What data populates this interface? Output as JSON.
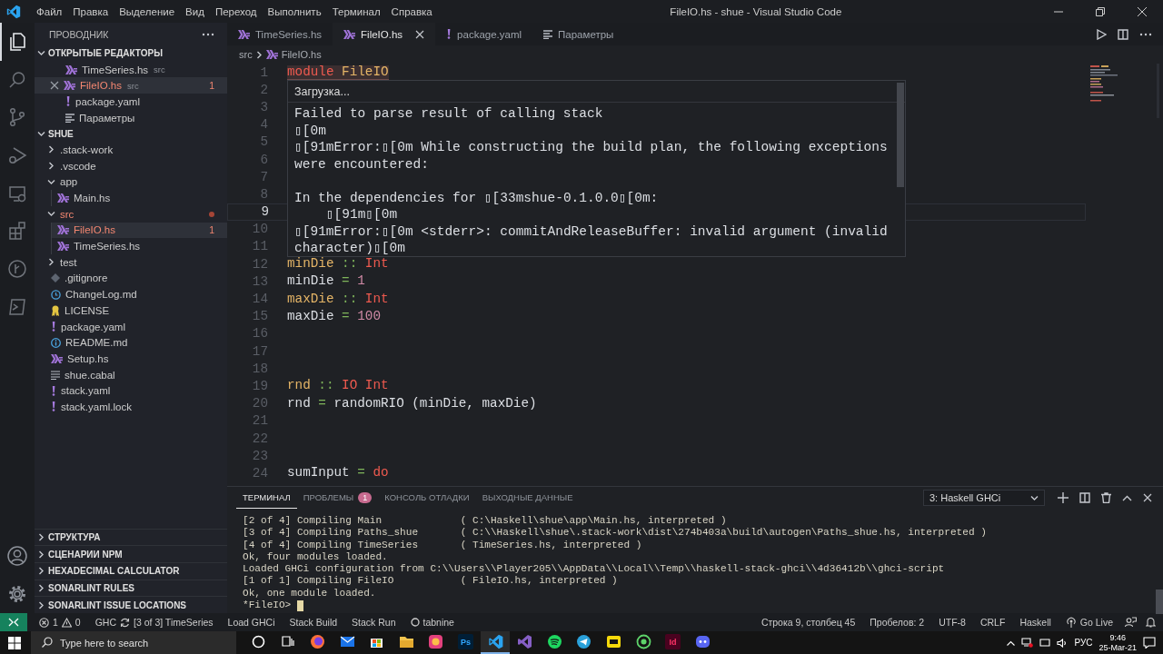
{
  "window": {
    "title": "FileIO.hs - shue - Visual Studio Code",
    "menu": [
      "Файл",
      "Правка",
      "Выделение",
      "Вид",
      "Переход",
      "Выполнить",
      "Терминал",
      "Справка"
    ]
  },
  "activity_bar": {
    "items": [
      {
        "kind": "explorer",
        "selected": true
      },
      {
        "kind": "search",
        "selected": false
      },
      {
        "kind": "source_control",
        "selected": false
      },
      {
        "kind": "run",
        "selected": false
      },
      {
        "kind": "remote",
        "selected": false
      },
      {
        "kind": "extensions",
        "selected": false
      },
      {
        "kind": "git_graph",
        "selected": false
      },
      {
        "kind": "terminal",
        "selected": false
      }
    ],
    "bottom": [
      {
        "kind": "account"
      },
      {
        "kind": "manage"
      }
    ]
  },
  "sidebar": {
    "title": "ПРОВОДНИК",
    "open_editors": {
      "title": "ОТКРЫТЫЕ РЕДАКТОРЫ",
      "expanded": true,
      "items": [
        {
          "name": "TimeSeries.hs",
          "kind": "haskell",
          "path": "src",
          "error": false,
          "selected": false
        },
        {
          "name": "FileIO.hs",
          "kind": "haskell",
          "path": "src",
          "error": true,
          "problems": "1",
          "selected": true
        },
        {
          "name": "package.yaml",
          "kind": "yaml",
          "error": false,
          "selected": false
        },
        {
          "name": "Параметры",
          "kind": "settings",
          "error": false,
          "selected": false
        }
      ]
    },
    "folder": {
      "title": "SHUE",
      "expanded": true,
      "items": [
        {
          "name": ".stack-work",
          "kind": "folder",
          "expanded": false,
          "error": false,
          "selected": false
        },
        {
          "name": ".vscode",
          "kind": "folder",
          "expanded": false,
          "error": false,
          "selected": false
        },
        {
          "name": "app",
          "kind": "folder",
          "expanded": true,
          "error": false,
          "selected": false,
          "children": [
            {
              "name": "Main.hs",
              "kind": "haskell",
              "error": false,
              "selected": false
            }
          ]
        },
        {
          "name": "src",
          "kind": "folder",
          "expanded": true,
          "error": true,
          "selected": false,
          "children": [
            {
              "name": "FileIO.hs",
              "kind": "haskell",
              "error": true,
              "problems": "1",
              "selected": true
            },
            {
              "name": "TimeSeries.hs",
              "kind": "haskell",
              "error": false,
              "selected": false
            }
          ]
        },
        {
          "name": "test",
          "kind": "folder",
          "expanded": false,
          "error": false,
          "selected": false
        },
        {
          "name": ".gitignore",
          "kind": "git",
          "error": false,
          "selected": false
        },
        {
          "name": "ChangeLog.md",
          "kind": "changelog",
          "error": false,
          "selected": false
        },
        {
          "name": "LICENSE",
          "kind": "license",
          "error": false,
          "selected": false
        },
        {
          "name": "package.yaml",
          "kind": "yaml",
          "error": false,
          "selected": false
        },
        {
          "name": "README.md",
          "kind": "readme",
          "error": false,
          "selected": false
        },
        {
          "name": "Setup.hs",
          "kind": "haskell",
          "error": false,
          "selected": false
        },
        {
          "name": "shue.cabal",
          "kind": "cabal",
          "error": false,
          "selected": false
        },
        {
          "name": "stack.yaml",
          "kind": "yaml",
          "error": false,
          "selected": false
        },
        {
          "name": "stack.yaml.lock",
          "kind": "yaml",
          "error": false,
          "selected": false
        }
      ]
    },
    "sections": [
      {
        "title": "СТРУКТУРА",
        "expanded": false
      },
      {
        "title": "СЦЕНАРИИ NPM",
        "expanded": false
      },
      {
        "title": "HEXADECIMAL CALCULATOR",
        "expanded": false
      },
      {
        "title": "SONARLINT RULES",
        "expanded": false
      },
      {
        "title": "SONARLINT ISSUE LOCATIONS",
        "expanded": false
      }
    ]
  },
  "editor": {
    "tabs": [
      {
        "label": "TimeSeries.hs",
        "kind": "haskell",
        "selected": false
      },
      {
        "label": "FileIO.hs",
        "kind": "haskell",
        "selected": true
      },
      {
        "label": "package.yaml",
        "kind": "yaml",
        "selected": false
      },
      {
        "label": "Параметры",
        "kind": "settings",
        "selected": false
      }
    ],
    "breadcrumb": [
      {
        "label": "src",
        "kind": "folder"
      },
      {
        "label": "FileIO.hs",
        "kind": "haskell"
      }
    ],
    "lines": [
      {
        "n": "1",
        "current": false,
        "highlight": true,
        "tokens": [
          {
            "text": "module",
            "kind": "keyword"
          },
          {
            "text": " FileIO",
            "kind": "name"
          }
        ]
      },
      {
        "n": "2",
        "current": false,
        "highlight": false
      },
      {
        "n": "3",
        "current": false,
        "highlight": false
      },
      {
        "n": "4",
        "current": false,
        "highlight": false
      },
      {
        "n": "5",
        "current": false,
        "highlight": false
      },
      {
        "n": "6",
        "current": false,
        "highlight": false
      },
      {
        "n": "7",
        "current": false,
        "highlight": false
      },
      {
        "n": "8",
        "current": false,
        "highlight": false
      },
      {
        "n": "9",
        "current": true,
        "highlight": false
      },
      {
        "n": "10",
        "current": false,
        "highlight": false
      },
      {
        "n": "11",
        "current": false,
        "highlight": false
      },
      {
        "n": "12",
        "current": false,
        "highlight": false,
        "tokens": [
          {
            "text": "minDie",
            "kind": "name"
          },
          {
            "text": " :: ",
            "kind": "op"
          },
          {
            "text": "Int",
            "kind": "type"
          }
        ]
      },
      {
        "n": "13",
        "current": false,
        "highlight": false,
        "tokens": [
          {
            "text": "minDie",
            "kind": "plain"
          },
          {
            "text": " = ",
            "kind": "op"
          },
          {
            "text": "1",
            "kind": "number"
          }
        ]
      },
      {
        "n": "14",
        "current": false,
        "highlight": false,
        "tokens": [
          {
            "text": "maxDie",
            "kind": "name"
          },
          {
            "text": " :: ",
            "kind": "op"
          },
          {
            "text": "Int",
            "kind": "type"
          }
        ]
      },
      {
        "n": "15",
        "current": false,
        "highlight": false,
        "tokens": [
          {
            "text": "maxDie",
            "kind": "plain"
          },
          {
            "text": " = ",
            "kind": "op"
          },
          {
            "text": "100",
            "kind": "number"
          }
        ]
      },
      {
        "n": "16",
        "current": false,
        "highlight": false
      },
      {
        "n": "17",
        "current": false,
        "highlight": false
      },
      {
        "n": "18",
        "current": false,
        "highlight": false
      },
      {
        "n": "19",
        "current": false,
        "highlight": false,
        "tokens": [
          {
            "text": "rnd",
            "kind": "name"
          },
          {
            "text": " :: ",
            "kind": "op"
          },
          {
            "text": "IO Int",
            "kind": "type"
          }
        ]
      },
      {
        "n": "20",
        "current": false,
        "highlight": false,
        "tokens": [
          {
            "text": "rnd",
            "kind": "plain"
          },
          {
            "text": " = ",
            "kind": "op"
          },
          {
            "text": "randomRIO (minDie, maxDie)",
            "kind": "plain"
          }
        ]
      },
      {
        "n": "21",
        "current": false,
        "highlight": false
      },
      {
        "n": "22",
        "current": false,
        "highlight": false
      },
      {
        "n": "23",
        "current": false,
        "highlight": false
      },
      {
        "n": "24",
        "current": false,
        "highlight": false,
        "tokens": [
          {
            "text": "sumInput",
            "kind": "plain"
          },
          {
            "text": " = ",
            "kind": "op"
          },
          {
            "text": "do",
            "kind": "keyword"
          }
        ]
      }
    ],
    "hover": {
      "title": "Загрузка...",
      "lines": [
        {
          "text": "Failed to parse result of calling stack",
          "gap_before": false
        },
        {
          "text": "▯[0m",
          "gap_before": false
        },
        {
          "text": "▯[91mError:▯[0m While constructing the build plan, the following exceptions",
          "gap_before": false
        },
        {
          "text": "were encountered:",
          "gap_before": false
        },
        {
          "text": "In the dependencies for ▯[33mshue-0.1.0.0▯[0m:",
          "gap_before": true
        },
        {
          "text": "    ▯[91m▯[0m",
          "gap_before": false
        },
        {
          "text": "▯[91mError:▯[0m <stderr>: commitAndReleaseBuffer: invalid argument (invalid",
          "gap_before": false
        },
        {
          "text": "character)▯[0m",
          "gap_before": false
        }
      ]
    }
  },
  "panel": {
    "tabs": [
      {
        "label": "ТЕРМИНАЛ",
        "selected": true
      },
      {
        "label": "ПРОБЛЕМЫ",
        "selected": false,
        "badge": "1"
      },
      {
        "label": "КОНСОЛЬ ОТЛАДКИ",
        "selected": false
      },
      {
        "label": "ВЫХОДНЫЕ ДАННЫЕ",
        "selected": false
      }
    ],
    "terminal_select": "3: Haskell GHCi",
    "terminal_lines": [
      "[2 of 4] Compiling Main             ( C:\\Haskell\\shue\\app\\Main.hs, interpreted )",
      "[3 of 4] Compiling Paths_shue       ( C:\\\\Haskell\\shue\\.stack-work\\dist\\274b403a\\build\\autogen\\Paths_shue.hs, interpreted )",
      "[4 of 4] Compiling TimeSeries       ( TimeSeries.hs, interpreted )",
      "Ok, four modules loaded.",
      "Loaded GHCi configuration from C:\\\\Users\\\\Player205\\\\AppData\\\\Local\\\\Temp\\\\haskell-stack-ghci\\\\4d36412b\\\\ghci-script",
      "[1 of 1] Compiling FileIO           ( FileIO.hs, interpreted )",
      "Ok, one module loaded."
    ],
    "prompt": "*FileIO> "
  },
  "status_bar": {
    "left": [
      {
        "kind": "remote"
      },
      {
        "kind": "problems",
        "errors": "1",
        "warnings": "0"
      },
      {
        "kind": "ghc",
        "label": "GHC",
        "text": "[3 of 3] TimeSeries"
      },
      {
        "kind": "text",
        "text": "Load GHCi"
      },
      {
        "kind": "text",
        "text": "Stack Build"
      },
      {
        "kind": "text",
        "text": "Stack Run"
      },
      {
        "kind": "tabnine",
        "text": "tabnine"
      }
    ],
    "right": [
      {
        "kind": "text",
        "text": "Строка 9, столбец 45"
      },
      {
        "kind": "text",
        "text": "Пробелов: 2"
      },
      {
        "kind": "text",
        "text": "UTF-8"
      },
      {
        "kind": "text",
        "text": "CRLF"
      },
      {
        "kind": "text",
        "text": "Haskell"
      },
      {
        "kind": "golive",
        "text": "Go Live"
      },
      {
        "kind": "feedback"
      },
      {
        "kind": "bell"
      }
    ]
  },
  "taskbar": {
    "search": {
      "placeholder": "Type here to search"
    },
    "apps": [
      {
        "kind": "cortana",
        "active": false
      },
      {
        "kind": "taskview",
        "active": false
      },
      {
        "kind": "firefox",
        "active": false
      },
      {
        "kind": "mail",
        "active": false
      },
      {
        "kind": "store",
        "active": false
      },
      {
        "kind": "explorer",
        "active": false
      },
      {
        "kind": "photos",
        "active": false
      },
      {
        "kind": "photoshop",
        "label": "Ps",
        "active": false
      },
      {
        "kind": "vscode",
        "active": true
      },
      {
        "kind": "visualstudio",
        "active": false
      },
      {
        "kind": "spotify",
        "active": false
      },
      {
        "kind": "telegram",
        "active": false
      },
      {
        "kind": "yellowapp",
        "active": false
      },
      {
        "kind": "whatsapp",
        "active": false
      },
      {
        "kind": "indesign",
        "label": "Id",
        "active": false
      },
      {
        "kind": "discord",
        "active": false
      }
    ],
    "tray": {
      "language": "РУС",
      "time": "9:46",
      "date": "25-Mar-21"
    }
  }
}
